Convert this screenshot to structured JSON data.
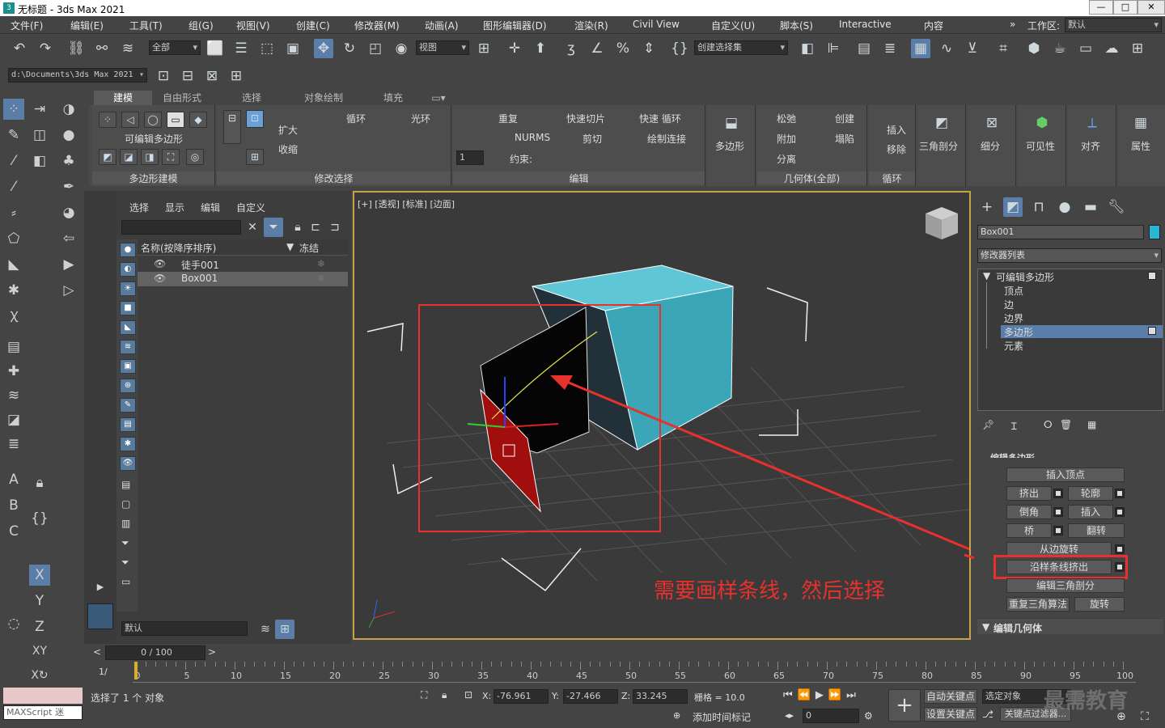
{
  "title": {
    "app": "无标题 - 3ds Max 2021",
    "logo_text": "3"
  },
  "window_buttons": {
    "minimize": "—",
    "maximize": "□",
    "close": "✕"
  },
  "menu": [
    "文件(F)",
    "编辑(E)",
    "工具(T)",
    "组(G)",
    "视图(V)",
    "创建(C)",
    "修改器(M)",
    "动画(A)",
    "图形编辑器(D)",
    "渲染(R)",
    "Civil View",
    "自定义(U)",
    "脚本(S)",
    "Interactive",
    "内容"
  ],
  "workspace": {
    "label": "工作区:",
    "value": "默认",
    "chevron": "»"
  },
  "toolbar": {
    "selection_filter": "全部",
    "ref_coord": "视图",
    "named_selection": "创建选择集",
    "path": "d:\\Documents\\3ds Max 2021"
  },
  "ribbon": {
    "tabs": [
      "建模",
      "自由形式",
      "选择",
      "对象绘制",
      "填充"
    ],
    "panel_poly_modeling": {
      "title": "可编辑多边形",
      "caption": "多边形建模"
    },
    "panel_modify_select": {
      "grow": "扩大",
      "shrink": "收缩",
      "loop": "循环",
      "ring": "光环",
      "caption": "修改选择"
    },
    "panel_edit": {
      "repeat": "重复",
      "quickslice": "快速切片",
      "quickloop": "快速 循环",
      "nurms": "NURMS",
      "cut": "剪切",
      "paintconnect": "绘制连接",
      "constraints": "约束:",
      "spinner": "1",
      "caption": "编辑"
    },
    "panel_polygons": {
      "label": "多边形"
    },
    "panel_geometry": {
      "relax": "松弛",
      "create": "创建",
      "attach": "附加",
      "collapse": "塌陷",
      "detach": "分离",
      "caption": "几何体(全部)"
    },
    "panel_loops": {
      "insert": "插入",
      "remove": "移除",
      "caption": "循环"
    },
    "big_buttons": [
      "三角剖分",
      "细分",
      "可见性",
      "对齐",
      "属性"
    ]
  },
  "scene_explorer": {
    "menu": [
      "选择",
      "显示",
      "编辑",
      "自定义"
    ],
    "col_name": "名称(按降序排序)",
    "col_frozen": "冻结",
    "rows": [
      {
        "name": "徒手001"
      },
      {
        "name": "Box001"
      }
    ],
    "layer": "默认"
  },
  "viewport": {
    "label": "[+] [透视] [标准] [边面]",
    "annotation": "需要画样条线，然后选择"
  },
  "command_panel": {
    "object_name": "Box001",
    "object_color": "#29b6d6",
    "modifier_list": "修改器列表",
    "stack": {
      "root": "可编辑多边形",
      "items": [
        "顶点",
        "边",
        "边界",
        "多边形",
        "元素"
      ],
      "selected_index": 3
    },
    "rollout_title": "编辑多边形",
    "buttons": {
      "insert_vertex": "插入顶点",
      "extrude": "挤出",
      "outline": "轮廓",
      "bevel": "倒角",
      "inset": "插入",
      "bridge": "桥",
      "flip": "翻转",
      "hinge": "从边旋转",
      "extrude_spline": "沿样条线挤出",
      "edit_tri": "编辑三角剖分",
      "retri": "重复三角算法",
      "turn": "旋转"
    },
    "geometry_rollout": "编辑几何体"
  },
  "timeline": {
    "frame": "0 / 100",
    "ticks": [
      "0",
      "5",
      "10",
      "15",
      "20",
      "25",
      "30",
      "35",
      "40",
      "45",
      "50",
      "55",
      "60",
      "65",
      "70",
      "75",
      "80",
      "85",
      "90",
      "95",
      "100"
    ]
  },
  "status": {
    "script": "MAXScript 迷",
    "selected": "选择了 1 个 对象",
    "x": "-76.961",
    "y": "-27.466",
    "z": "33.245",
    "grid": "栅格 = 10.0",
    "add_time_tag": "添加时间标记",
    "auto_key": "自动关键点",
    "set_key": "设置关键点",
    "selected_obj": "选定对象",
    "key_filters": "关键点过滤器...",
    "frame_field": "0",
    "watermark": "最需教育"
  },
  "colors": {
    "accent_red": "#e8302c",
    "selection_blue": "#5b7ea8",
    "viewport_border": "#c8a24a"
  }
}
